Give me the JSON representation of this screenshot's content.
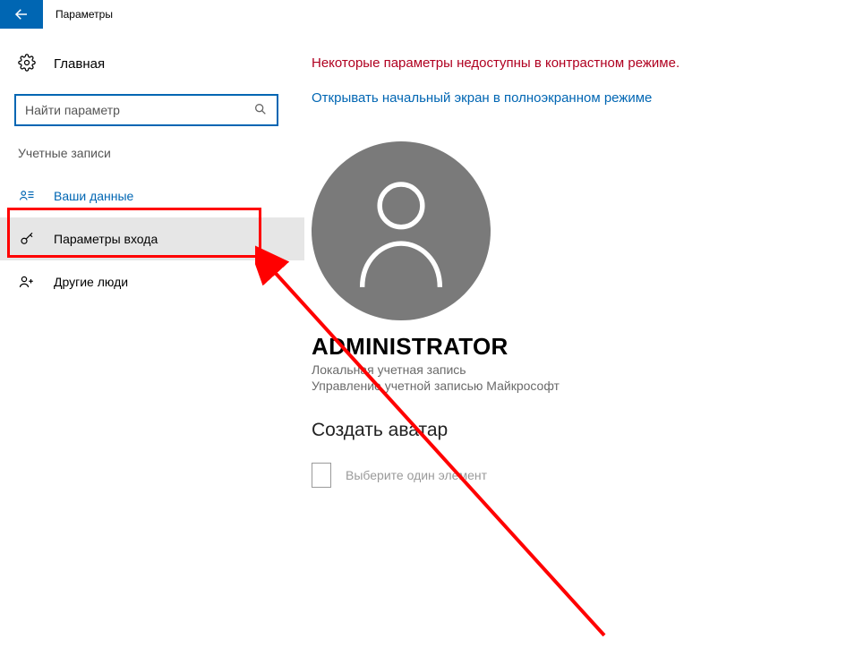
{
  "titlebar": {
    "title": "Параметры"
  },
  "sidebar": {
    "home_label": "Главная",
    "search_placeholder": "Найти параметр",
    "section_label": "Учетные записи",
    "items": [
      {
        "label": "Ваши данные"
      },
      {
        "label": "Параметры входа"
      },
      {
        "label": "Другие люди"
      }
    ]
  },
  "main": {
    "warning": "Некоторые параметры недоступны в контрастном режиме.",
    "fullscreen_link": "Открывать начальный экран в полноэкранном режиме",
    "user_name": "ADMINISTRATOR",
    "account_type": "Локальная учетная запись",
    "manage_link": "Управление учетной записью Майкрософт",
    "create_avatar_heading": "Создать аватар",
    "picker_hint": "Выберите один элемент"
  }
}
